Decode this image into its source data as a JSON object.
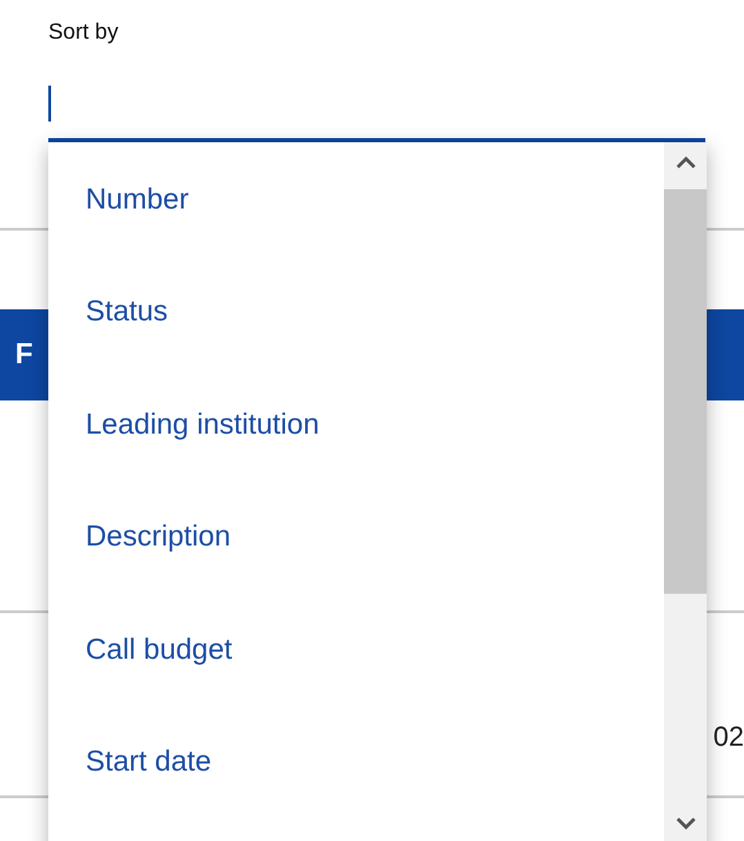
{
  "sort_field": {
    "label": "Sort by",
    "focused": true
  },
  "dropdown": {
    "options": [
      {
        "label": "Number",
        "selected": false
      },
      {
        "label": "Status",
        "selected": false
      },
      {
        "label": "Leading institution",
        "selected": false
      },
      {
        "label": "Description",
        "selected": false
      },
      {
        "label": "Call budget",
        "selected": false
      },
      {
        "label": "Start date",
        "selected": false
      }
    ]
  },
  "background": {
    "banner_text": "F",
    "row_text": "02"
  }
}
